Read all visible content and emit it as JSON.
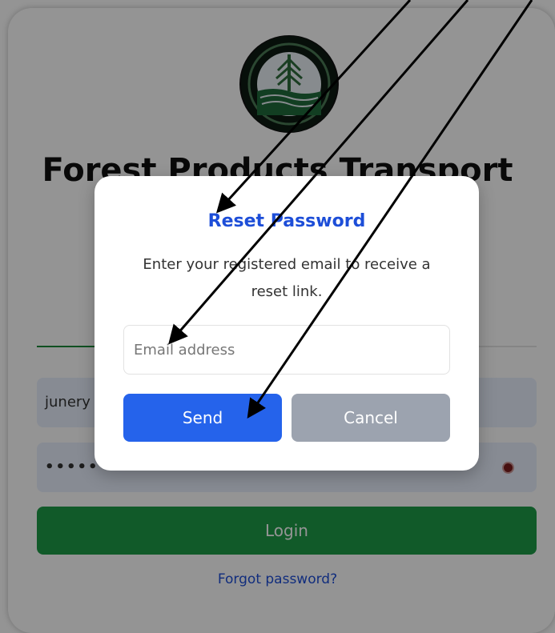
{
  "background": {
    "title": "Forest Products Transport",
    "username_value": "junery",
    "password_value": "•••••••",
    "login_label": "Login",
    "forgot_label": "Forgot password?"
  },
  "modal": {
    "title": "Reset Password",
    "message": "Enter your registered email to receive a reset link.",
    "email_placeholder": "Email address",
    "send_label": "Send",
    "cancel_label": "Cancel"
  },
  "colors": {
    "modal_title": "#1d4ed8",
    "send_button": "#2563eb",
    "cancel_button": "#9ca3af",
    "login_button": "#1e9b48",
    "link": "#1e4ed8"
  },
  "icons": {
    "logo": "department-seal-icon",
    "password_toggle": "eye-icon",
    "annotation": "arrow-icon"
  }
}
